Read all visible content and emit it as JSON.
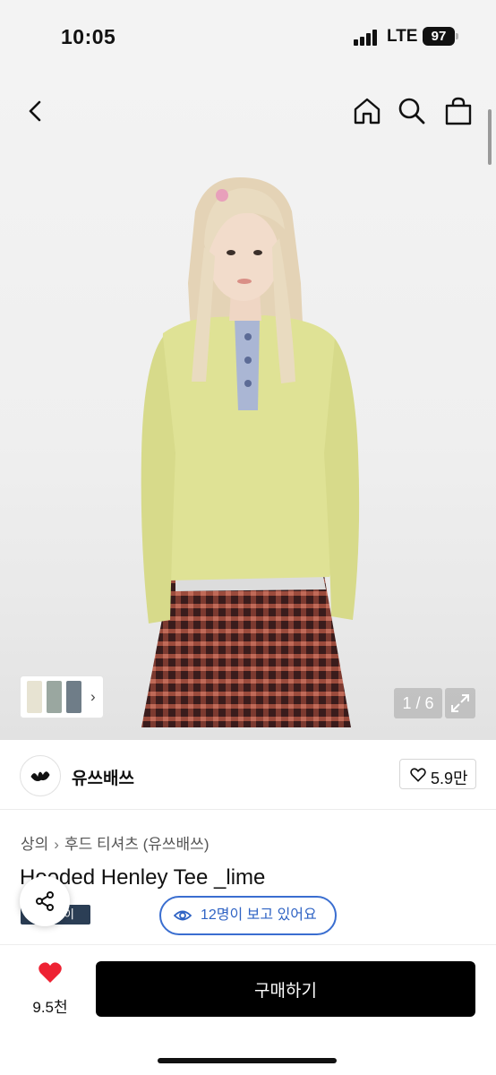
{
  "status_bar": {
    "time": "10:05",
    "network": "LTE",
    "battery": "97"
  },
  "nav": {
    "icons": [
      "back-icon",
      "home-icon",
      "search-icon",
      "shopping-bag-icon"
    ]
  },
  "gallery": {
    "counter": "1 / 6",
    "thumb_colors": [
      "#e7e3d2",
      "#9aa7a0",
      "#6f7d88"
    ],
    "shirt_color": "#dfe295",
    "skirt_colors": [
      "#3a1c1c",
      "#9b4b3c"
    ]
  },
  "shop": {
    "name": "유쓰배쓰",
    "like_count": "5.9만"
  },
  "product": {
    "breadcrumb": [
      "상의",
      "후드 티셔츠 (유쓰배쓰)"
    ],
    "title": "Hooded Henley Tee _lime",
    "badge": "페이"
  },
  "viewers": {
    "text": "12명이 보고 있어요"
  },
  "bottom": {
    "wish_count": "9.5천",
    "buy_label": "구매하기"
  },
  "colors": {
    "accent_blue": "#2f63c4",
    "heart_red": "#ee2233",
    "badge_navy": "#2b3e55",
    "buy_black": "#000000"
  }
}
